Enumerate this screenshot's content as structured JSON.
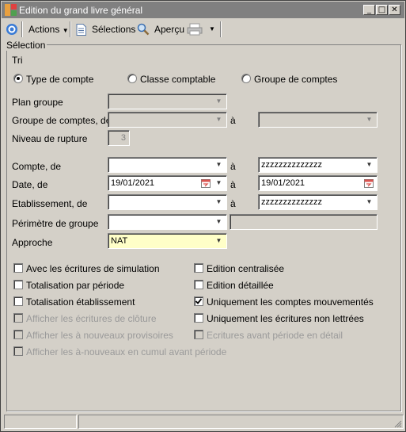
{
  "window": {
    "title": "Edition du grand livre général",
    "buttons": {
      "minimize": "_",
      "maximize": "□",
      "close": "✕"
    }
  },
  "toolbar": {
    "actions_label": "Actions",
    "selections_label": "Sélections",
    "preview_label": "Aperçu"
  },
  "section": {
    "selection_label": "Sélection",
    "sort_label": "Tri"
  },
  "sort": {
    "options": [
      {
        "label": "Type de compte",
        "selected": true
      },
      {
        "label": "Classe comptable",
        "selected": false
      },
      {
        "label": "Groupe de comptes",
        "selected": false
      }
    ]
  },
  "form": {
    "plan_groupe_label": "Plan groupe",
    "groupe_comptes_label": "Groupe de comptes, de",
    "a_label": "à",
    "niveau_rupture_label": "Niveau de rupture",
    "niveau_rupture_value": "3",
    "compte_label": "Compte, de",
    "compte_from": "",
    "compte_to": "zzzzzzzzzzzzzz",
    "date_label": "Date, de",
    "date_from": "19/01/2021",
    "date_to": "19/01/2021",
    "etablissement_label": "Etablissement, de",
    "etablissement_from": "",
    "etablissement_to": "zzzzzzzzzzzzzz",
    "perimetre_label": "Périmètre de groupe",
    "approche_label": "Approche",
    "approche_value": "NAT"
  },
  "options_left": [
    {
      "label": "Avec les écritures de simulation",
      "checked": false,
      "enabled": true
    },
    {
      "label": "Totalisation par période",
      "checked": false,
      "enabled": true
    },
    {
      "label": "Totalisation établissement",
      "checked": false,
      "enabled": true
    },
    {
      "label": "Afficher les écritures de clôture",
      "checked": false,
      "enabled": false
    },
    {
      "label": "Afficher les à nouveaux provisoires",
      "checked": false,
      "enabled": false
    },
    {
      "label": "Afficher les à-nouveaux en cumul avant période",
      "checked": false,
      "enabled": false
    }
  ],
  "options_right": [
    {
      "label": "Edition centralisée",
      "checked": false,
      "enabled": true
    },
    {
      "label": "Edition détaillée",
      "checked": false,
      "enabled": true
    },
    {
      "label": "Uniquement les comptes mouvementés",
      "checked": true,
      "enabled": true
    },
    {
      "label": "Uniquement les écritures non lettrées",
      "checked": false,
      "enabled": true
    },
    {
      "label": "Ecritures avant période en détail",
      "checked": false,
      "enabled": false
    }
  ],
  "colors": {
    "titlebar": "#808080",
    "window_bg": "#d4d0c8",
    "approche_bg": "#ffffc8"
  },
  "icons": [
    "app-icon",
    "target-icon",
    "document-icon",
    "magnifier-icon",
    "printer-icon",
    "calendar-icon",
    "chevron-down-icon"
  ]
}
